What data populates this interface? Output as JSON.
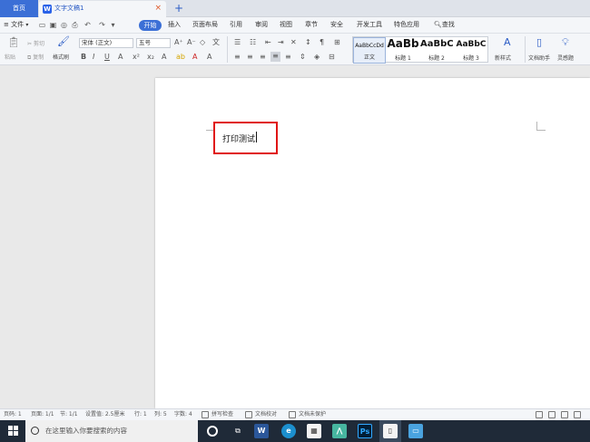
{
  "tabs": {
    "home": "首页",
    "document": "文字文稿1",
    "close": "×",
    "add": "+"
  },
  "menu": {
    "file": "文件",
    "start": "开始",
    "items": [
      "插入",
      "页面布局",
      "引用",
      "审阅",
      "视图",
      "章节",
      "安全",
      "开发工具",
      "特色应用"
    ],
    "search": "查找"
  },
  "ribbon": {
    "paste": "粘贴",
    "cut": "剪切",
    "copy": "复制",
    "format_painter": "格式刷",
    "font_name": "宋体 (正文)",
    "font_size": "五号",
    "styles": [
      {
        "preview": "AaBbCcDd",
        "label": "正文"
      },
      {
        "preview": "AaBb",
        "label": "标题 1"
      },
      {
        "preview": "AaBbC",
        "label": "标题 2"
      },
      {
        "preview": "AaBbC",
        "label": "标题 3"
      }
    ],
    "new_style": "新样式",
    "doc_assistant": "文档助手",
    "inspiration": "灵感题"
  },
  "document": {
    "text": "打印测试"
  },
  "status": {
    "page_num": "页码: 1",
    "pages": "页面: 1/1",
    "section": "节: 1/1",
    "setting": "设置值: 2.5厘米",
    "row": "行: 1",
    "col": "列: 5",
    "words": "字数: 4",
    "spell": "拼写检查",
    "proof": "文档校对",
    "protect": "文档未保护"
  },
  "taskbar": {
    "search_placeholder": "在这里输入你要搜索的内容"
  },
  "colors": {
    "accent": "#3b6fd6",
    "highlight": "#e01515",
    "taskbar": "#1f2a38"
  }
}
